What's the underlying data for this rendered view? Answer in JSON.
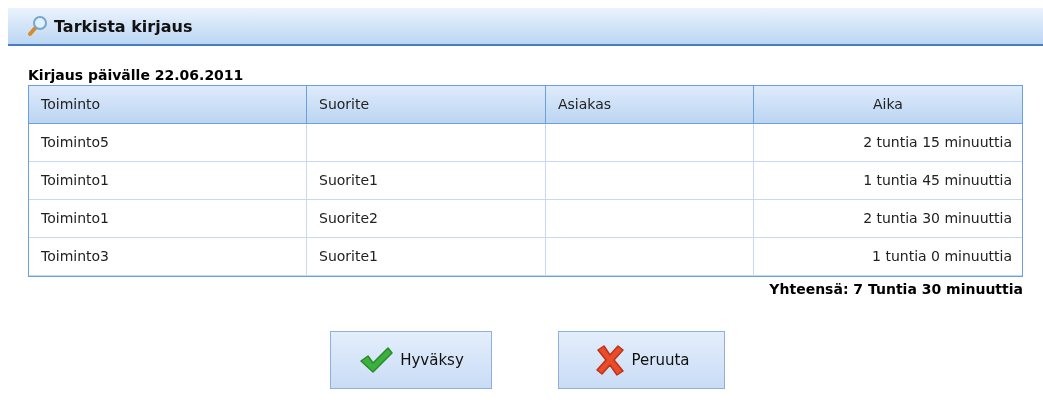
{
  "window": {
    "title": "Tarkista kirjaus"
  },
  "heading": "Kirjaus päivälle 22.06.2011",
  "table": {
    "columns": [
      {
        "label": "Toiminto"
      },
      {
        "label": "Suorite"
      },
      {
        "label": "Asiakas"
      },
      {
        "label": "Aika"
      }
    ],
    "rows": [
      {
        "cells": [
          "Toiminto5",
          null,
          null,
          "2 tuntia 15 minuuttia"
        ]
      },
      {
        "cells": [
          "Toiminto1",
          "Suorite1",
          null,
          "1 tuntia 45 minuuttia"
        ]
      },
      {
        "cells": [
          "Toiminto1",
          "Suorite2",
          null,
          "2 tuntia 30 minuuttia"
        ]
      },
      {
        "cells": [
          "Toiminto3",
          "Suorite1",
          null,
          "1 tuntia 0 minuuttia"
        ]
      }
    ]
  },
  "total": "Yhteensä: 7 Tuntia 30 minuuttia",
  "buttons": [
    {
      "label": "Hyväksy",
      "kind": "accept"
    },
    {
      "label": "Peruuta",
      "kind": "cancel"
    }
  ]
}
